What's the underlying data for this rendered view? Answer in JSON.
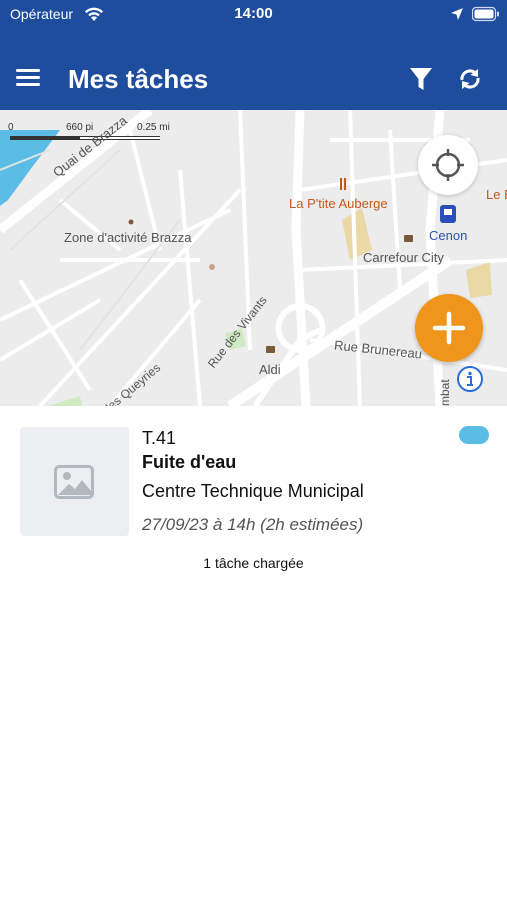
{
  "status_bar": {
    "carrier": "Opérateur",
    "time": "14:00"
  },
  "app_bar": {
    "title": "Mes tâches",
    "menu_icon": "hamburger-menu-icon",
    "filter_icon": "filter-icon",
    "sync_icon": "sync-icon"
  },
  "map": {
    "scale": {
      "zero": "0",
      "feet": "660 pi",
      "miles": "0.25 mi"
    },
    "labels": {
      "quai": "Quai de Brazza",
      "zone": "Zone d'activité Brazza",
      "restaurant": "La P'tite Auberge",
      "restaurant_partial": "Le B",
      "station": "Cenon",
      "carrefour": "Carrefour City",
      "vivants": "Rue des Vivants",
      "brunereau": "Rue Brunereau",
      "aldi": "Aldi",
      "queyries": "des Queyries",
      "mbat": "mbat"
    },
    "buttons": {
      "locate_icon": "crosshair-icon",
      "add_icon": "plus-icon",
      "info_icon": "info-icon"
    },
    "colors": {
      "water": "#5bbde6",
      "land": "#ececec",
      "park": "#cfeac2",
      "sand": "#ead9a7",
      "road": "#ffffff"
    }
  },
  "task": {
    "id": "T.41",
    "title": "Fuite d'eau",
    "location": "Centre Technique Municipal",
    "date": "27/09/23 à 14h (2h estimées)",
    "thumbnail_icon": "image-placeholder-icon",
    "status_color": "#5bbde6"
  },
  "footer": {
    "loaded_count": "1 tâche chargée"
  },
  "theme": {
    "primary": "#1f4d9e",
    "accent": "#f0951c"
  }
}
